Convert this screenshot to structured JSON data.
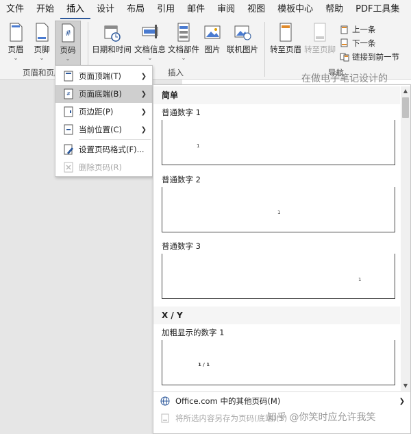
{
  "menubar": {
    "tabs": [
      "文件",
      "开始",
      "插入",
      "设计",
      "布局",
      "引用",
      "邮件",
      "审阅",
      "视图",
      "模板中心",
      "帮助",
      "PDF工具集"
    ],
    "active_tab": "插入"
  },
  "ribbon": {
    "buttons": {
      "header": "页眉",
      "footer": "页脚",
      "page_number": "页码",
      "date_time": "日期和时间",
      "doc_info": "文档信息",
      "doc_parts": "文档部件",
      "picture": "图片",
      "online_picture": "联机图片",
      "goto_header": "转至页眉",
      "goto_footer": "转至页脚",
      "previous": "上一条",
      "next": "下一条",
      "link_previous": "链接到前一节"
    },
    "groups": {
      "header_footer": "页眉和页脚",
      "insert": "插入",
      "navigation": "导航"
    }
  },
  "document": {
    "header_text": "在做电子笔记设计的"
  },
  "menu": {
    "items": [
      {
        "label": "页面顶端(T)"
      },
      {
        "label": "页面底端(B)"
      },
      {
        "label": "页边距(P)"
      },
      {
        "label": "当前位置(C)"
      },
      {
        "label": "设置页码格式(F)..."
      },
      {
        "label": "删除页码(R)"
      }
    ]
  },
  "gallery": {
    "section_simple": "简单",
    "entries": [
      {
        "title": "普通数字 1",
        "num": "1"
      },
      {
        "title": "普通数字 2",
        "num": "1"
      },
      {
        "title": "普通数字 3",
        "num": "1"
      }
    ],
    "section_xy": "X / Y",
    "entry_bold": {
      "title": "加粗显示的数字 1",
      "num": "1 / 1"
    },
    "more_label": "Office.com 中的其他页码(M)",
    "save_label": "将所选内容另存为页码(底端)(S)"
  },
  "watermark": "知乎 @你笑时应允许我笑"
}
